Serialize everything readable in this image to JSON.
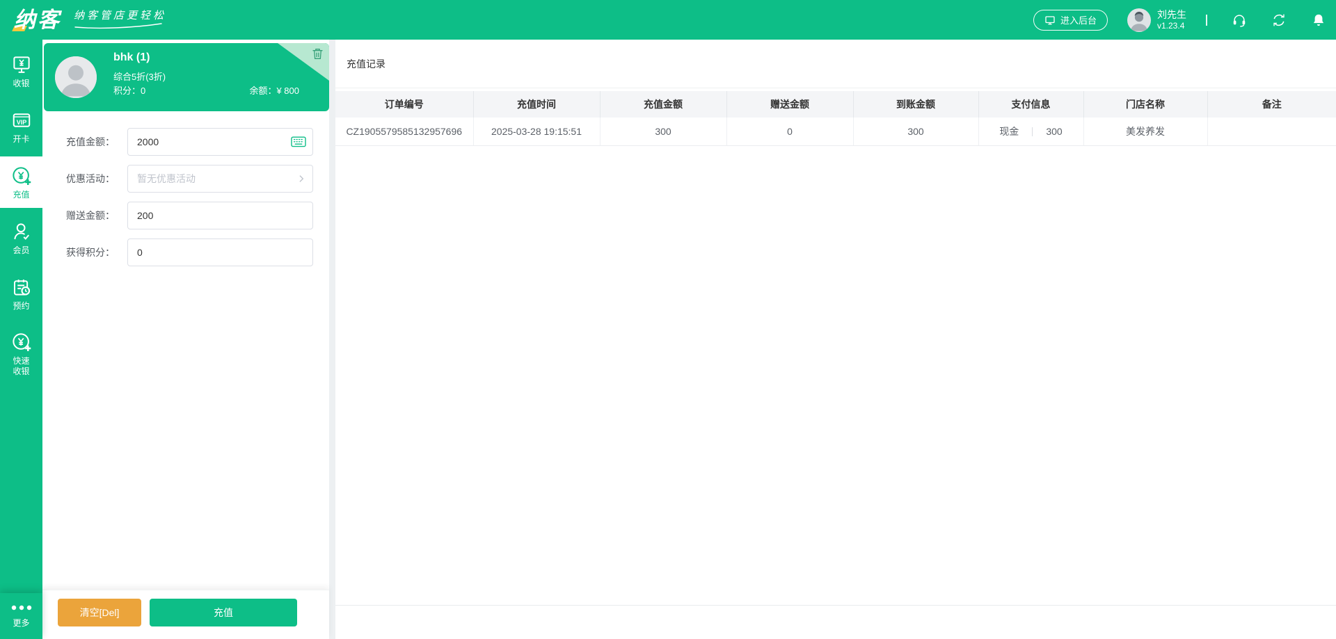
{
  "colors": {
    "primary_green": "#0dbe87",
    "fold_green": "#b7e8d1",
    "clear_orange": "#eba43b"
  },
  "topbar": {
    "logo_text": "纳客",
    "tagline": "纳客管店更轻松",
    "backend_button": "进入后台",
    "user": {
      "name": "刘先生",
      "version": "v1.23.4"
    }
  },
  "sidebar": {
    "items": [
      {
        "label": "收银"
      },
      {
        "label": "开卡"
      },
      {
        "label": "充值"
      },
      {
        "label": "会员"
      },
      {
        "label": "预约"
      },
      {
        "label": "快速收银"
      }
    ],
    "more_label": "更多"
  },
  "member_card": {
    "name": "bhk (1)",
    "discount": "综合5折(3折)",
    "points_label": "积分：",
    "points_value": "0",
    "balance_label": "余额：",
    "balance_value": "¥ 800"
  },
  "form": {
    "fields": [
      {
        "label": "充值金额：",
        "value": "2000",
        "suffix_icon": "keyboard-icon"
      },
      {
        "label": "优惠活动：",
        "value": "",
        "placeholder": "暂无优惠活动",
        "suffix_icon": "chevron-right-icon"
      },
      {
        "label": "赠送金额：",
        "value": "200",
        "suffix_icon": ""
      },
      {
        "label": "获得积分：",
        "value": "0",
        "suffix_icon": ""
      }
    ],
    "clear_button": "清空[Del]",
    "recharge_button": "充值"
  },
  "main": {
    "title": "充值记录",
    "table": {
      "headers": [
        "订单编号",
        "充值时间",
        "充值金额",
        "赠送金额",
        "到账金额",
        "支付信息",
        "门店名称",
        "备注"
      ],
      "rows": [
        {
          "order_no": "CZ1905579585132957696",
          "time": "2025-03-28 19:15:51",
          "amount": "300",
          "gift": "0",
          "received": "300",
          "pay_method": "现金",
          "pay_amount": "300",
          "store": "美发养发",
          "remark": ""
        }
      ]
    }
  }
}
